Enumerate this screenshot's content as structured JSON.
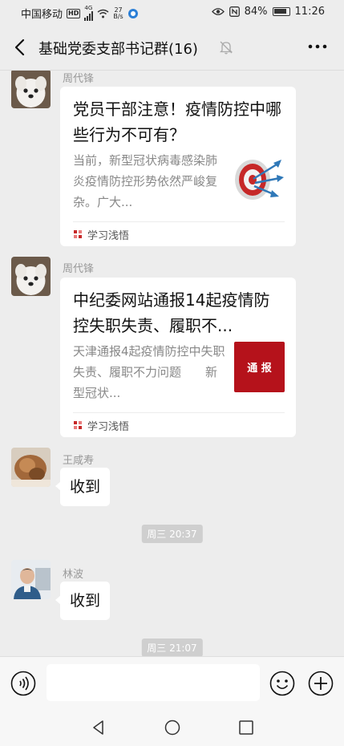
{
  "status_bar": {
    "carrier": "中国移动",
    "network_badge": "HD",
    "network_type": "4G",
    "speed_value": "27",
    "speed_unit": "B/s",
    "battery": "84%",
    "time": "11:26"
  },
  "header": {
    "title": "基础党委支部书记群(16)"
  },
  "messages": [
    {
      "sender": "周代锋",
      "type": "article",
      "title": "党员干部注意！疫情防控中哪些行为不可有？",
      "desc": "当前，新型冠状病毒感染肺炎疫情防控形势依然严峻复杂。广大...",
      "source": "学习浅悟",
      "thumb_icon": "target-darts-icon"
    },
    {
      "sender": "周代锋",
      "type": "article",
      "title": "中纪委网站通报14起疫情防控失职失责、履职不...",
      "desc": "天津通报4起疫情防控中失职失责、履职不力问题　　新型冠状...",
      "source": "学习浅悟",
      "thumb_label": "通 报"
    },
    {
      "sender": "王咸寿",
      "type": "text",
      "text": "收到"
    },
    {
      "type": "time",
      "text": "周三 20:37"
    },
    {
      "sender": "林波",
      "type": "text",
      "text": "收到"
    },
    {
      "type": "time",
      "text": "周三 21:07"
    }
  ],
  "colors": {
    "background": "#ededed",
    "bubble": "#ffffff",
    "thumb_red": "#b5121b"
  }
}
